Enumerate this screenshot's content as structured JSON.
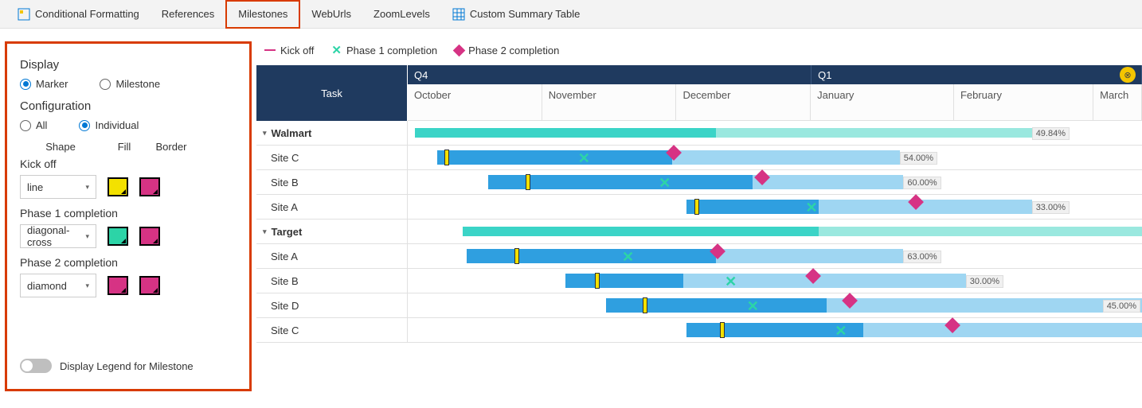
{
  "toolbar": {
    "items": [
      {
        "label": "Conditional Formatting",
        "icon": "format-icon"
      },
      {
        "label": "References"
      },
      {
        "label": "Milestones",
        "selected": true
      },
      {
        "label": "WebUrls"
      },
      {
        "label": "ZoomLevels"
      },
      {
        "label": "Custom Summary Table",
        "icon": "table-icon"
      }
    ]
  },
  "panel": {
    "display_label": "Display",
    "display_options": [
      "Marker",
      "Milestone"
    ],
    "display_selected": "Marker",
    "config_label": "Configuration",
    "config_options": [
      "All",
      "Individual"
    ],
    "config_selected": "Individual",
    "col_headers": [
      "Shape",
      "Fill",
      "Border"
    ],
    "milestones": [
      {
        "name": "Kick off",
        "shape": "line",
        "fill": "#f3e100",
        "border": "#d63384"
      },
      {
        "name": "Phase 1 completion",
        "shape": "diagonal-cross",
        "fill": "#2cd4a7",
        "border": "#d63384"
      },
      {
        "name": "Phase 2 completion",
        "shape": "diamond",
        "fill": "#d63384",
        "border": "#d63384"
      }
    ],
    "toggle_label": "Display Legend for Milestone",
    "toggle_on": false
  },
  "legend": [
    {
      "type": "line",
      "label": "Kick off",
      "color": "#d63384"
    },
    {
      "type": "cross",
      "label": "Phase 1 completion",
      "color": "#2cd4a7"
    },
    {
      "type": "diamond",
      "label": "Phase 2 completion",
      "color": "#d63384"
    }
  ],
  "gantt": {
    "task_header": "Task",
    "quarters": [
      {
        "label": "Q4",
        "width_pct": 55
      },
      {
        "label": "Q1",
        "width_pct": 45
      }
    ],
    "months": [
      {
        "label": "October",
        "width_pct": 18.3
      },
      {
        "label": "November",
        "width_pct": 18.3
      },
      {
        "label": "December",
        "width_pct": 18.3
      },
      {
        "label": "January",
        "width_pct": 19.5
      },
      {
        "label": "February",
        "width_pct": 19
      },
      {
        "label": "March",
        "width_pct": 6.6
      }
    ],
    "corner_icon": "⊗"
  },
  "chart_data": {
    "type": "bar",
    "title": "",
    "xlabel": "",
    "ylabel": "",
    "groups": [
      {
        "name": "Walmart",
        "summary": {
          "teal_start": 1,
          "teal_end": 42,
          "light_start": 42,
          "light_end": 85,
          "pct": "49.84%"
        },
        "rows": [
          {
            "name": "Site C",
            "dark_start": 4,
            "dark_end": 36,
            "light_end": 67,
            "pct": "54.00%",
            "kick": 5,
            "p1": 24,
            "p2": 36
          },
          {
            "name": "Site B",
            "dark_start": 11,
            "dark_end": 47,
            "light_end": 67.5,
            "pct": "60.00%",
            "kick": 16,
            "p1": 35,
            "p2": 48
          },
          {
            "name": "Site A",
            "dark_start": 38,
            "dark_end": 56,
            "light_end": 85,
            "pct": "33.00%",
            "kick": 39,
            "p1": 55,
            "p2": 69
          }
        ]
      },
      {
        "name": "Target",
        "summary": {
          "teal_start": 7.5,
          "teal_end": 56,
          "light_start": 56,
          "light_end": 100,
          "pct": ""
        },
        "rows": [
          {
            "name": "Site A",
            "dark_start": 8,
            "dark_end": 42,
            "light_end": 67.5,
            "pct": "63.00%",
            "kick": 14.5,
            "p1": 30,
            "p2": 42
          },
          {
            "name": "Site B",
            "dark_start": 21.5,
            "dark_end": 37.5,
            "light_end": 76,
            "pct": "30.00%",
            "kick": 25.5,
            "p1": 44,
            "p2": 55
          },
          {
            "name": "Site D",
            "dark_start": 27,
            "dark_end": 57,
            "light_end": 100,
            "pct": "45.00%",
            "kick": 32,
            "p1": 47,
            "p2": 60,
            "pct_right": true
          },
          {
            "name": "Site C",
            "dark_start": 38,
            "dark_end": 62,
            "light_end": 100,
            "pct": "",
            "kick": 42.5,
            "p1": 59,
            "p2": 74
          }
        ]
      }
    ]
  }
}
